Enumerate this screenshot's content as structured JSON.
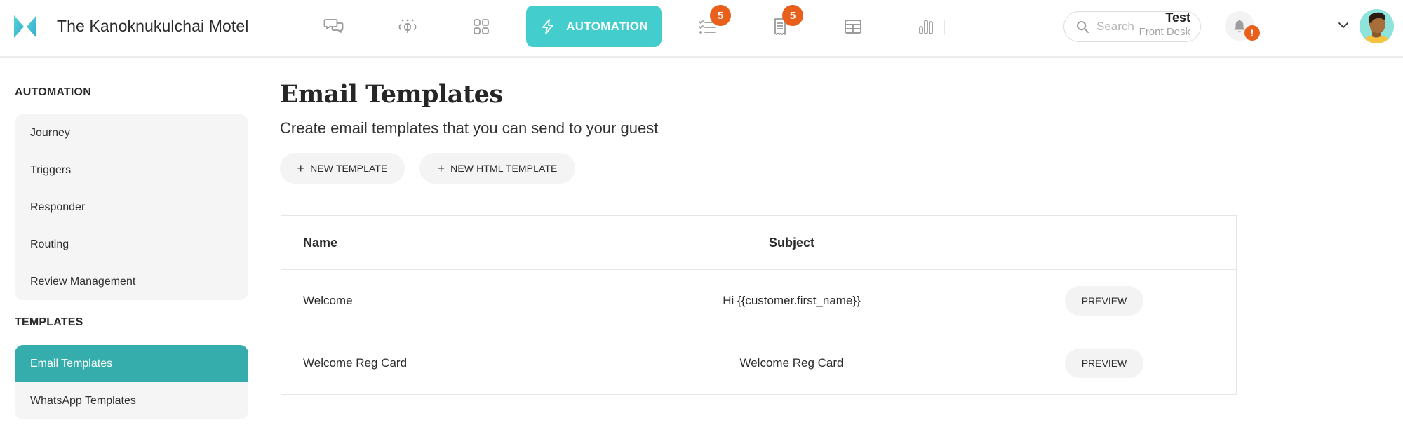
{
  "header": {
    "app_title": "The Kanoknukulchai Motel",
    "nav": [
      {
        "icon": "chat-bubbles-icon",
        "label": ""
      },
      {
        "icon": "guests-group-icon",
        "label": ""
      },
      {
        "icon": "grid-apps-icon",
        "label": ""
      },
      {
        "icon": "lightning-icon",
        "label": "AUTOMATION",
        "active": true
      },
      {
        "icon": "checklist-icon",
        "label": "",
        "badge": "5"
      },
      {
        "icon": "receipt-icon",
        "label": "",
        "badge": "5"
      },
      {
        "icon": "table-layout-icon",
        "label": ""
      },
      {
        "icon": "bar-chart-icon",
        "label": ""
      }
    ],
    "search": {
      "placeholder": "Search",
      "value": ""
    },
    "notifications_badge": "!",
    "user": {
      "name": "Test",
      "role": "Front Desk"
    }
  },
  "sidebar": {
    "sections": [
      {
        "heading": "AUTOMATION",
        "items": [
          {
            "label": "Journey"
          },
          {
            "label": "Triggers"
          },
          {
            "label": "Responder"
          },
          {
            "label": "Routing"
          },
          {
            "label": "Review Management"
          }
        ]
      },
      {
        "heading": "TEMPLATES",
        "items": [
          {
            "label": "Email Templates",
            "active": true
          },
          {
            "label": "WhatsApp Templates"
          }
        ]
      }
    ]
  },
  "main": {
    "title": "Email Templates",
    "subtitle": "Create email templates that you can send to your guest",
    "buttons": {
      "new_template": "NEW TEMPLATE",
      "new_html_template": "NEW HTML TEMPLATE",
      "plus": "+"
    },
    "table": {
      "columns": [
        "Name",
        "Subject",
        ""
      ],
      "rows": [
        {
          "name": "Welcome",
          "subject": "Hi {{customer.first_name}}",
          "action": "PREVIEW"
        },
        {
          "name": "Welcome Reg Card",
          "subject": "Welcome Reg Card",
          "action": "PREVIEW"
        }
      ]
    }
  },
  "colors": {
    "accent": "#43cdcd",
    "sidebar_active": "#35adad",
    "badge": "#e8601c"
  }
}
